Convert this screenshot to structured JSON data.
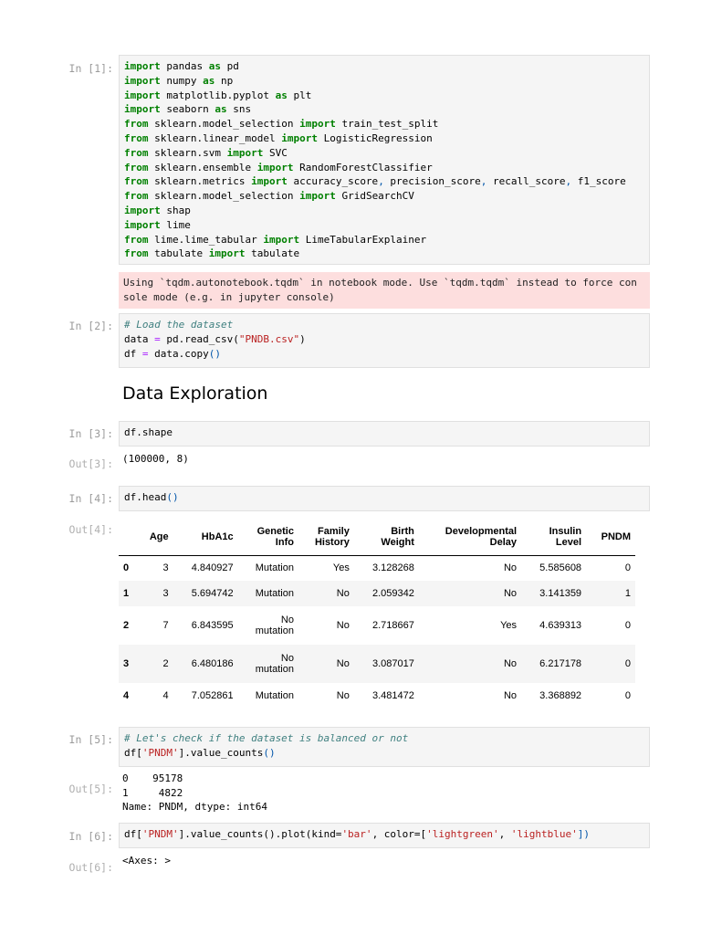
{
  "cells": {
    "c1": {
      "prompt": "In [1]:",
      "stderr_lines": [
        "Using `tqdm.autonotebook.tqdm` in notebook mode. Use `tqdm.tqdm` instead to force con",
        "sole mode (e.g. in jupyter console)"
      ]
    },
    "c2": {
      "prompt": "In [2]:"
    },
    "c3": {
      "prompt": "In [3]:",
      "out_prompt": "Out[3]:",
      "output": "(100000, 8)"
    },
    "c4": {
      "prompt": "In [4]:",
      "out_prompt": "Out[4]:"
    },
    "c5": {
      "prompt": "In [5]:",
      "out_prompt": "Out[5]:",
      "output_lines": [
        "0    95178",
        "1     4822",
        "Name: PNDM, dtype: int64"
      ]
    },
    "c6": {
      "prompt": "In [6]:",
      "out_prompt": "Out[6]:",
      "output": "<Axes: >"
    }
  },
  "code_tokens": {
    "import": "import",
    "from": "from",
    "as": "as",
    "eq": "=",
    "pandas": " pandas ",
    "pd": " pd",
    "numpy": " numpy ",
    "np": " np",
    "matplotlib": " matplotlib.pyplot ",
    "plt": " plt",
    "seaborn": " seaborn ",
    "sns": " sns",
    "ms_mod": " sklearn.model_selection ",
    "tts": " train_test_split",
    "lm_mod": " sklearn.linear_model ",
    "logreg": " LogisticRegression",
    "svm_mod": " sklearn.svm ",
    "svc": " SVC",
    "ens_mod": " sklearn.ensemble ",
    "rfc": " RandomForestClassifier",
    "met_mod": " sklearn.metrics ",
    "acc": " accuracy_score",
    "comma": ",",
    "prec": " precision_score",
    "rec": " recall_score",
    "f1": " f1_score",
    "gscv": " GridSearchCV",
    "shap": " shap",
    "lime": " lime",
    "lime_mod": " lime.lime_tabular ",
    "lte": " LimeTabularExplainer",
    "tab_mod": " tabulate ",
    "tab": " tabulate",
    "c2_comment": "# Load the dataset",
    "data": "data ",
    "read": " pd.read_csv(",
    "csv": "\"PNDB.csv\"",
    "close": ")",
    "df": "df ",
    "copy": " data.copy",
    "parens": "()",
    "df_shape": "df.shape",
    "df_head": "df.head",
    "c5_comment": "# Let's check if the dataset is balanced or not",
    "df_open": "df[",
    "pndm": "'PNDM'",
    "vc": "].value_counts",
    "vc_plot": "].value_counts().plot(kind=",
    "bar": "'bar'",
    "colorkw": ", color=[",
    "lg": "'lightgreen'",
    "lb": "'lightblue'",
    "close_br": "])"
  },
  "section_heading": "Data Exploration",
  "dataframe": {
    "columns": [
      [
        "",
        ""
      ],
      [
        "",
        "Age"
      ],
      [
        "",
        "HbA1c"
      ],
      [
        "Genetic",
        "Info"
      ],
      [
        "Family",
        "History"
      ],
      [
        "Birth",
        "Weight"
      ],
      [
        "Developmental",
        "Delay"
      ],
      [
        "Insulin",
        "Level"
      ],
      [
        "",
        "PNDM"
      ]
    ],
    "rows": [
      {
        "idx": "0",
        "age": "3",
        "hba1c": "4.840927",
        "genetic": [
          "",
          "Mutation"
        ],
        "family": "Yes",
        "birth": "3.128268",
        "dev": "No",
        "insulin": "5.585608",
        "pndm": "0"
      },
      {
        "idx": "1",
        "age": "3",
        "hba1c": "5.694742",
        "genetic": [
          "",
          "Mutation"
        ],
        "family": "No",
        "birth": "2.059342",
        "dev": "No",
        "insulin": "3.141359",
        "pndm": "1"
      },
      {
        "idx": "2",
        "age": "7",
        "hba1c": "6.843595",
        "genetic": [
          "No",
          "mutation"
        ],
        "family": "No",
        "birth": "2.718667",
        "dev": "Yes",
        "insulin": "4.639313",
        "pndm": "0"
      },
      {
        "idx": "3",
        "age": "2",
        "hba1c": "6.480186",
        "genetic": [
          "No",
          "mutation"
        ],
        "family": "No",
        "birth": "3.087017",
        "dev": "No",
        "insulin": "6.217178",
        "pndm": "0"
      },
      {
        "idx": "4",
        "age": "4",
        "hba1c": "7.052861",
        "genetic": [
          "",
          "Mutation"
        ],
        "family": "No",
        "birth": "3.481472",
        "dev": "No",
        "insulin": "3.368892",
        "pndm": "0"
      }
    ]
  }
}
